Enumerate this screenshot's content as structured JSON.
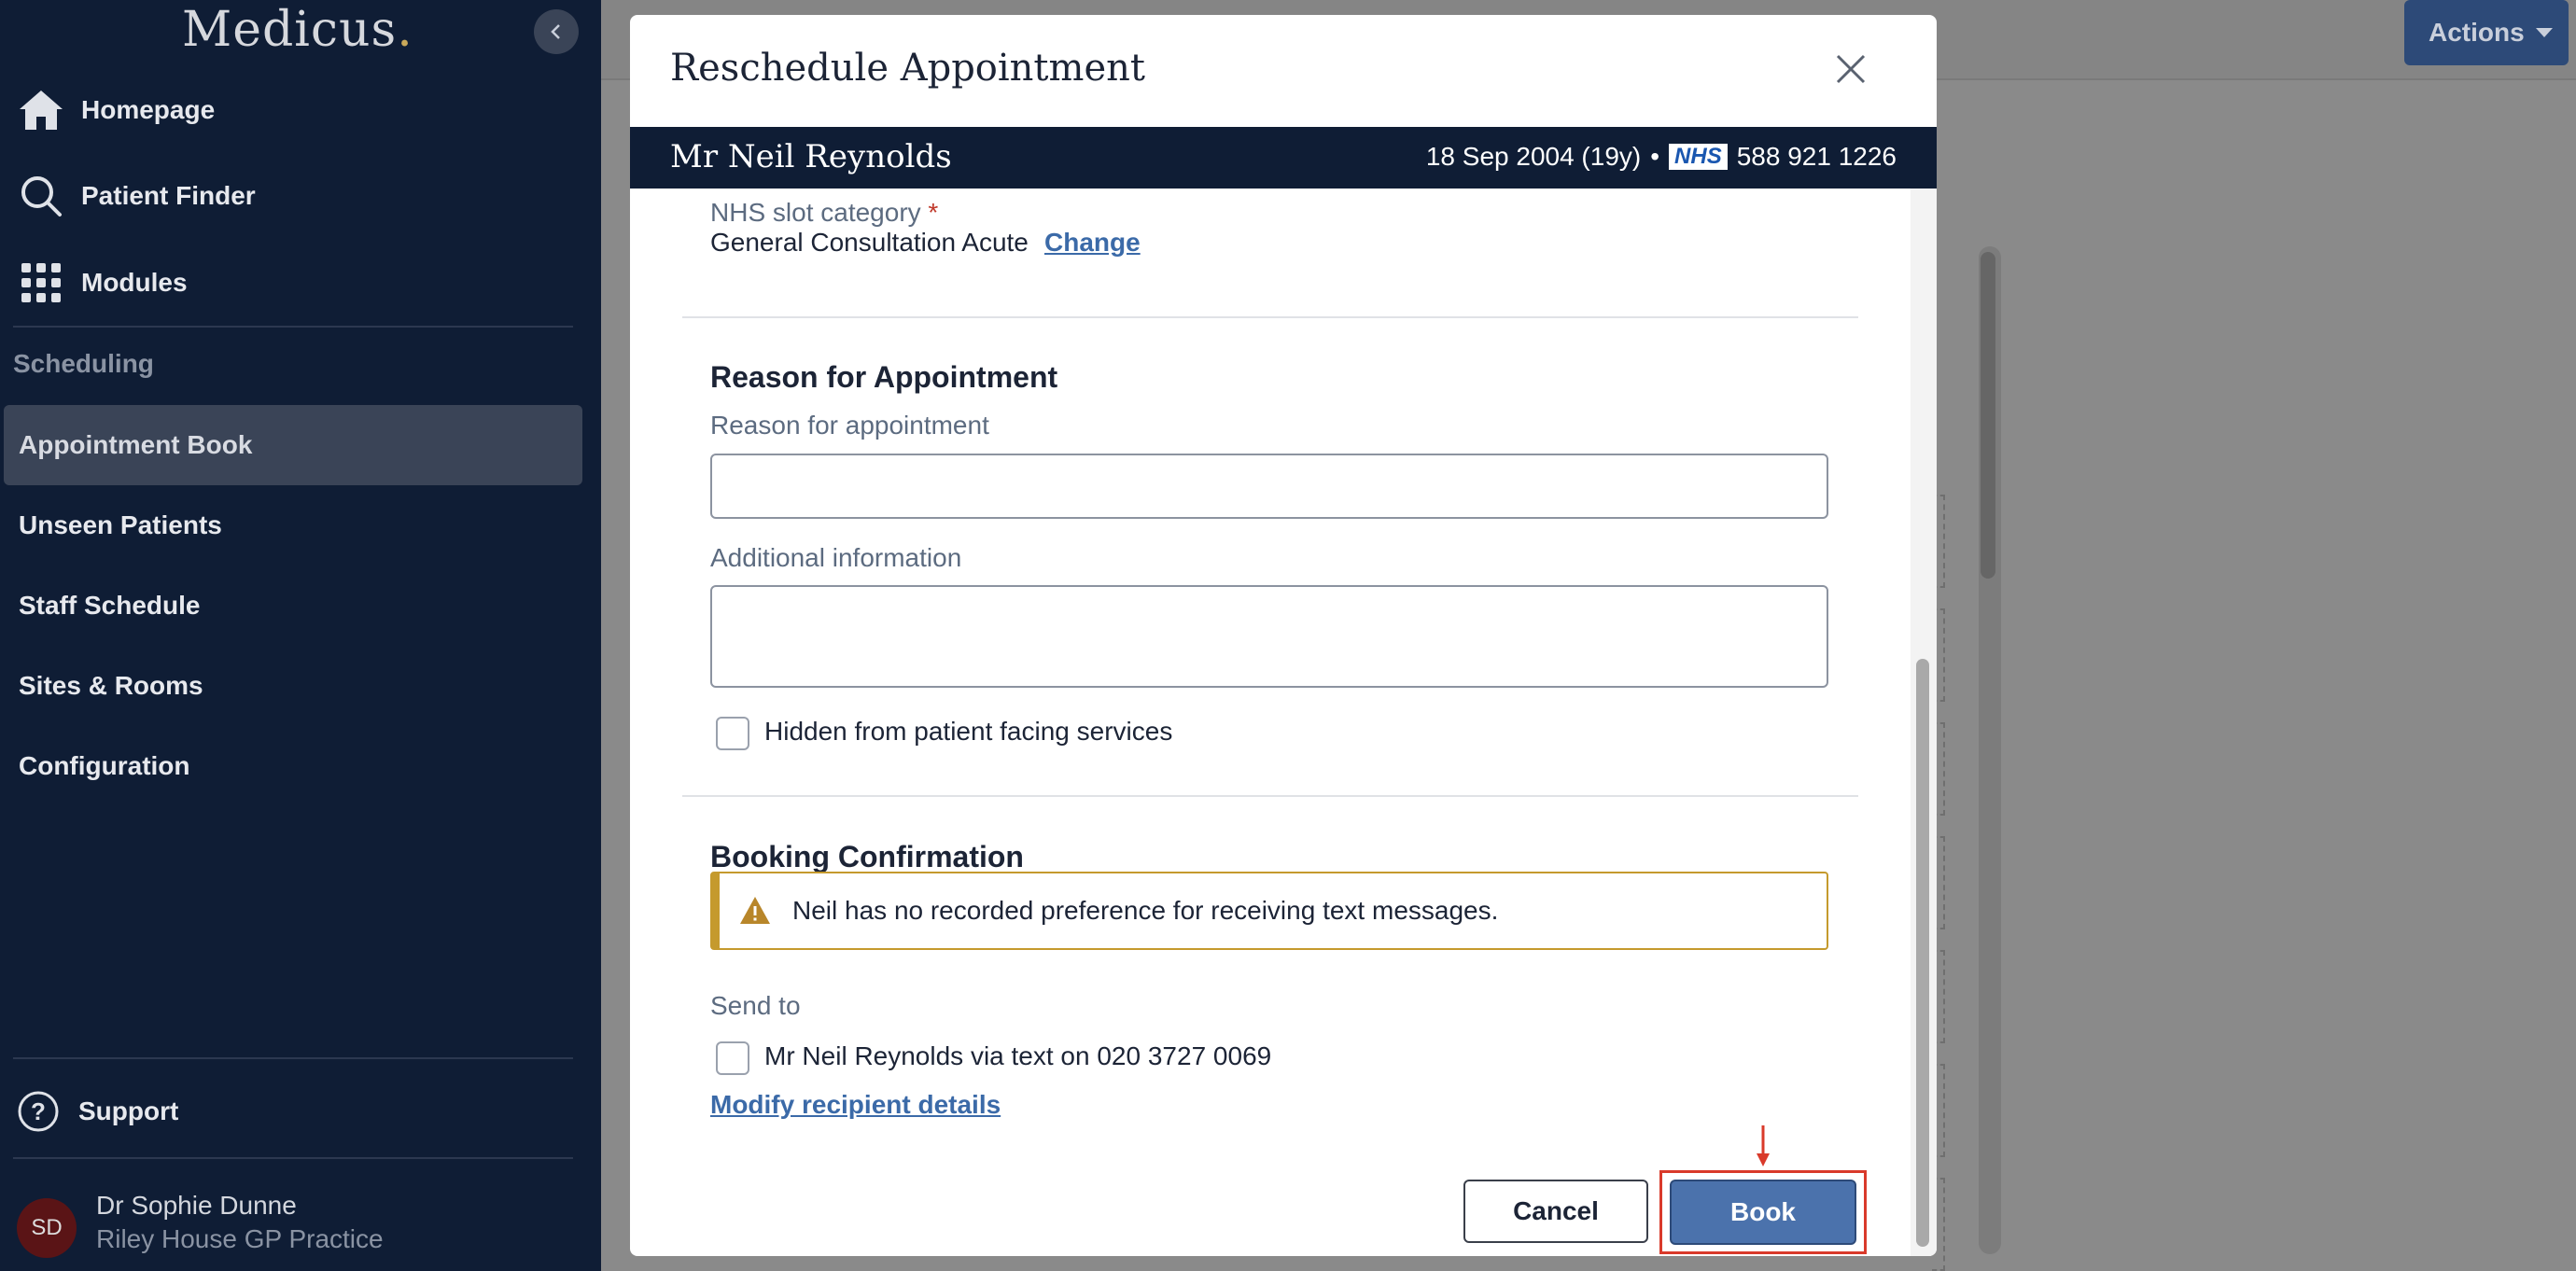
{
  "app": {
    "logo": "Medicus",
    "logo_dot": "."
  },
  "sidebar": {
    "nav": [
      {
        "label": "Homepage",
        "icon": "home-icon"
      },
      {
        "label": "Patient Finder",
        "icon": "search-icon"
      },
      {
        "label": "Modules",
        "icon": "grid-icon"
      }
    ],
    "section": "Scheduling",
    "items": [
      {
        "label": "Appointment Book",
        "active": true
      },
      {
        "label": "Unseen Patients"
      },
      {
        "label": "Staff Schedule"
      },
      {
        "label": "Sites & Rooms"
      },
      {
        "label": "Configuration"
      }
    ],
    "support": "Support",
    "user": {
      "initials": "SD",
      "name": "Dr Sophie Dunne",
      "practice": "Riley House GP Practice"
    }
  },
  "header": {
    "actions_label": "Actions"
  },
  "modal": {
    "title": "Reschedule Appointment",
    "patient": {
      "name": "Mr Neil Reynolds",
      "dob": "18 Sep 2004 (19y)",
      "separator": "•",
      "nhs_logo": "NHS",
      "nhs_number": "588 921 1226"
    },
    "slot_category": {
      "label": "NHS slot category",
      "required_mark": "*",
      "value": "General Consultation Acute",
      "change_label": "Change"
    },
    "reason": {
      "section_title": "Reason for Appointment",
      "reason_label": "Reason for appointment",
      "reason_value": "",
      "additional_label": "Additional information",
      "additional_value": "",
      "hidden_label": "Hidden from patient facing services",
      "hidden_checked": false
    },
    "confirmation": {
      "section_title": "Booking Confirmation",
      "warning": "Neil has no recorded preference for receiving text messages.",
      "send_to_label": "Send to",
      "recipient_label": "Mr Neil Reynolds via text on 020 3727 0069",
      "recipient_checked": false,
      "modify_label": "Modify recipient details"
    },
    "buttons": {
      "cancel": "Cancel",
      "book": "Book"
    }
  },
  "colors": {
    "sidebar_bg": "#0f1d35",
    "primary": "#4b72ac",
    "link": "#3b6aa8",
    "warning": "#c59a2d",
    "highlight": "#d93a2b"
  }
}
